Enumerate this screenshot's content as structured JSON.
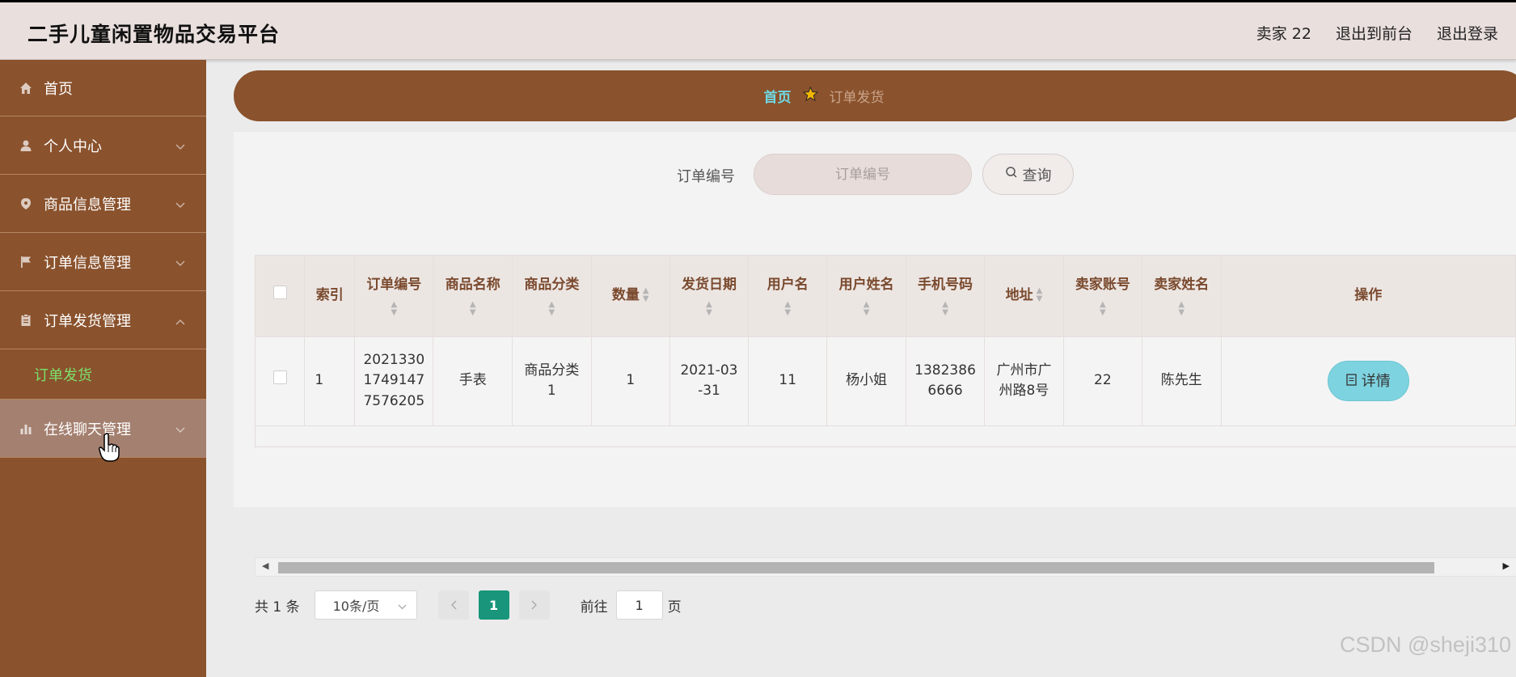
{
  "header": {
    "title": "二手儿童闲置物品交易平台",
    "user": "卖家 22",
    "back_to_front": "退出到前台",
    "logout": "退出登录"
  },
  "sidebar": {
    "items": [
      {
        "label": "首页",
        "icon": "home-icon"
      },
      {
        "label": "个人中心",
        "icon": "person-icon"
      },
      {
        "label": "商品信息管理",
        "icon": "pin-icon"
      },
      {
        "label": "订单信息管理",
        "icon": "flag-icon"
      },
      {
        "label": "订单发货管理",
        "icon": "clipboard-icon"
      },
      {
        "label": "在线聊天管理",
        "icon": "bar-chart-icon"
      }
    ],
    "submenu": {
      "label": "订单发货"
    }
  },
  "breadcrumb": {
    "home": "首页",
    "current": "订单发货",
    "separator_icon": "star-icon"
  },
  "search": {
    "label": "订单编号",
    "placeholder": "订单编号",
    "button": "查询"
  },
  "table": {
    "headers": [
      "索引",
      "订单编号",
      "商品名称",
      "商品分类",
      "数量",
      "发货日期",
      "用户名",
      "用户姓名",
      "手机号码",
      "地址",
      "卖家账号",
      "卖家姓名",
      "操作"
    ],
    "rows": [
      {
        "index": "1",
        "order_no": "20213301749147757 6205",
        "order_no_lines": [
          "2021330",
          "1749147",
          "7576205"
        ],
        "product_name": "手表",
        "category_lines": [
          "商品分类",
          "1"
        ],
        "quantity": "1",
        "ship_date_lines": [
          "2021-03",
          "-31"
        ],
        "username": "11",
        "user_realname": "杨小姐",
        "phone_lines": [
          "1382386",
          "6666"
        ],
        "address_lines": [
          "广州市广",
          "州路8号"
        ],
        "seller_account": "22",
        "seller_name": "陈先生",
        "action": "详情"
      }
    ]
  },
  "pagination": {
    "total": "共 1 条",
    "page_size": "10条/页",
    "current_page": "1",
    "goto_label": "前往",
    "goto_value": "1",
    "page_suffix": "页"
  },
  "watermark": "CSDN @sheji310",
  "colors": {
    "sidebar": "#8a522d",
    "header": "#e9dfdd",
    "active_submenu": "#7ce06a",
    "breadcrumb_home": "#6fd8e3",
    "detail_button": "#7ed3e0",
    "active_page": "#18957a"
  }
}
